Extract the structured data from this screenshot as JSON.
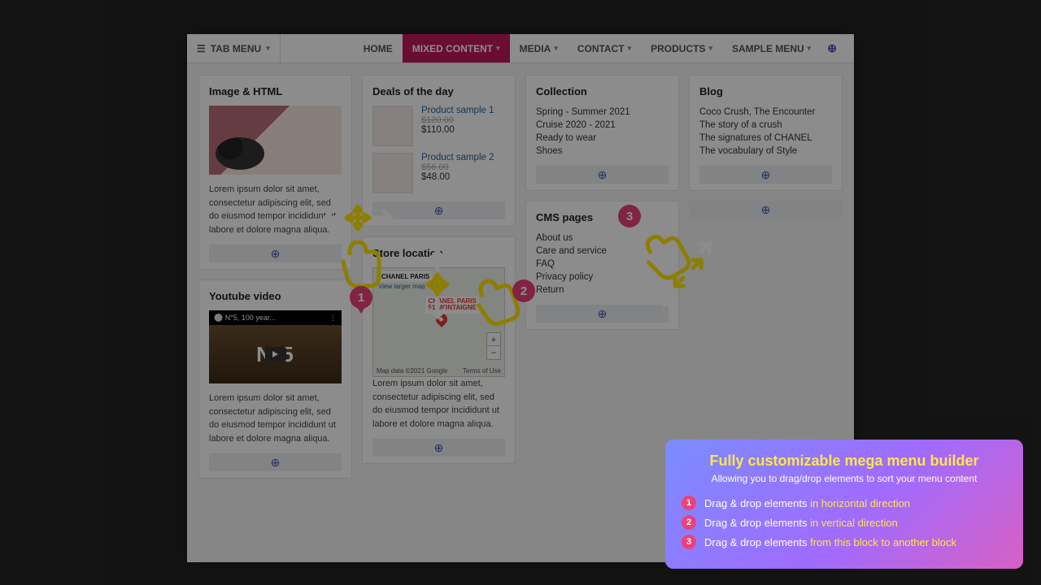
{
  "nav": {
    "tab_menu": "TAB MENU",
    "items": [
      "HOME",
      "MIXED CONTENT",
      "MEDIA",
      "CONTACT",
      "PRODUCTS",
      "SAMPLE MENU"
    ],
    "active_index": 1
  },
  "cols": [
    [
      {
        "title": "Image & HTML",
        "type": "hero",
        "text": "Lorem ipsum dolor sit amet, consectetur adipiscing elit, sed do eiusmod tempor incididunt ut labore et dolore magna aliqua."
      },
      {
        "title": "Youtube video",
        "type": "yt",
        "yt_title": "N°5, 100 year...",
        "text": "Lorem ipsum dolor sit amet, consectetur adipiscing elit, sed do eiusmod tempor incididunt ut labore et dolore magna aliqua."
      }
    ],
    [
      {
        "title": "Deals of the day",
        "type": "products",
        "products": [
          {
            "name": "Product sample 1",
            "old": "$120.00",
            "price": "$110.00"
          },
          {
            "name": "Product sample 2",
            "old": "$56.00",
            "price": "$48.00"
          }
        ]
      },
      {
        "title": "Store location",
        "type": "map",
        "map": {
          "header": "CHANEL PARIS",
          "link": "View larger map",
          "balloon_l1": "CHANEL PARIS",
          "balloon_l2": "51 MONTAIGNE",
          "credit_left": "Map data ©2021 Google",
          "credit_right": "Terms of Use"
        },
        "text": "Lorem ipsum dolor sit amet, consectetur adipiscing elit, sed do eiusmod tempor incididunt ut labore et dolore magna aliqua."
      }
    ],
    [
      {
        "title": "Collection",
        "type": "links",
        "links": [
          "Spring - Summer 2021",
          "Cruise 2020 - 2021",
          "Ready to wear",
          "Shoes"
        ]
      },
      {
        "title": "CMS pages",
        "type": "links",
        "links": [
          "About us",
          "Care and service",
          "FAQ",
          "Privacy policy",
          "Return"
        ]
      }
    ],
    [
      {
        "title": "Blog",
        "type": "links",
        "links": [
          "Coco Crush, The Encounter",
          "The story of a crush",
          "The signatures of CHANEL",
          "The vocabulary of Style"
        ]
      }
    ]
  ],
  "panel": {
    "title": "Fully customizable mega menu builder",
    "sub": "Allowing you to drag/drop elements to sort your menu content",
    "rows": [
      {
        "n": "1",
        "a": "Drag & drop elements ",
        "b": "in horizontal direction"
      },
      {
        "n": "2",
        "a": "Drag & drop elements ",
        "b": "in vertical direction"
      },
      {
        "n": "3",
        "a": "Drag & drop elements ",
        "b": "from this block to another block"
      }
    ]
  },
  "gizmo_badges": {
    "g1": "1",
    "g2": "2",
    "g3": "3"
  },
  "yt_big": "N°5"
}
